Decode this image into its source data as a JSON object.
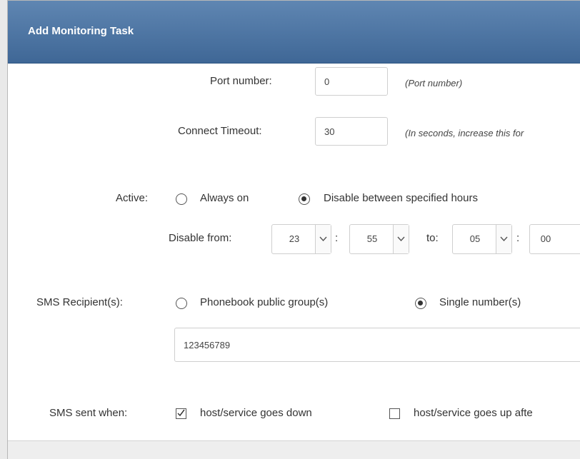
{
  "dialog": {
    "title": "Add Monitoring Task"
  },
  "port": {
    "label": "Port number:",
    "value": "0",
    "hint": "(Port number)"
  },
  "timeout": {
    "label": "Connect Timeout:",
    "value": "30",
    "hint": "(In seconds, increase this for"
  },
  "active": {
    "label": "Active:",
    "options": [
      "Always on",
      "Disable between specified hours"
    ],
    "selected": "Disable between specified hours"
  },
  "disable": {
    "label": "Disable from:",
    "from_hour": "23",
    "from_minute": "55",
    "to_label": "to:",
    "to_hour": "05",
    "to_minute": "00",
    "separator": ":"
  },
  "sms": {
    "label": "SMS Recipient(s):",
    "options": [
      "Phonebook public group(s)",
      "Single number(s)"
    ],
    "selected": "Single number(s)",
    "numbers": "123456789"
  },
  "sent_when": {
    "label": "SMS sent when:",
    "options": [
      {
        "label": "host/service goes down",
        "checked": true
      },
      {
        "label": "host/service goes up afte",
        "checked": false
      }
    ]
  }
}
